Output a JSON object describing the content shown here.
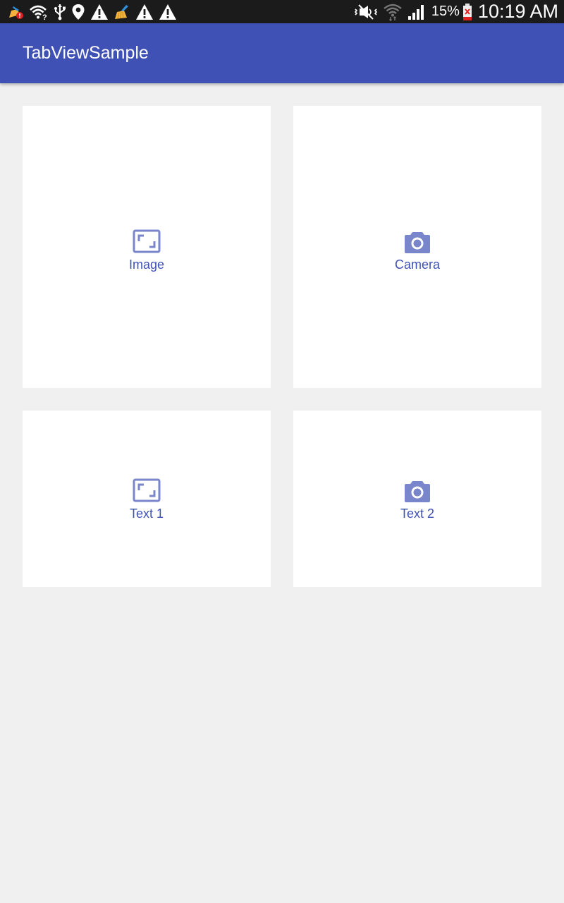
{
  "status_bar": {
    "left_icons": [
      "clean-master-alert-icon",
      "wifi-question-icon",
      "usb-icon",
      "location-icon",
      "warning-icon",
      "broom-icon",
      "warning-icon",
      "warning-icon"
    ],
    "right_icons": [
      "vibrate-mute-icon",
      "wifi-icon",
      "cell-signal-icon",
      "battery-icon"
    ],
    "battery_percent": "15%",
    "time": "10:19 AM"
  },
  "app_bar": {
    "title": "TabViewSample",
    "color": "#3f51b5"
  },
  "cards": [
    {
      "label": "Image",
      "icon": "image-frame-icon"
    },
    {
      "label": "Camera",
      "icon": "camera-icon"
    },
    {
      "label": "Text 1",
      "icon": "image-frame-icon"
    },
    {
      "label": "Text 2",
      "icon": "camera-icon"
    }
  ],
  "colors": {
    "accent": "#3f51b5",
    "icon": "#7986cb",
    "background": "#f0f0f0"
  }
}
